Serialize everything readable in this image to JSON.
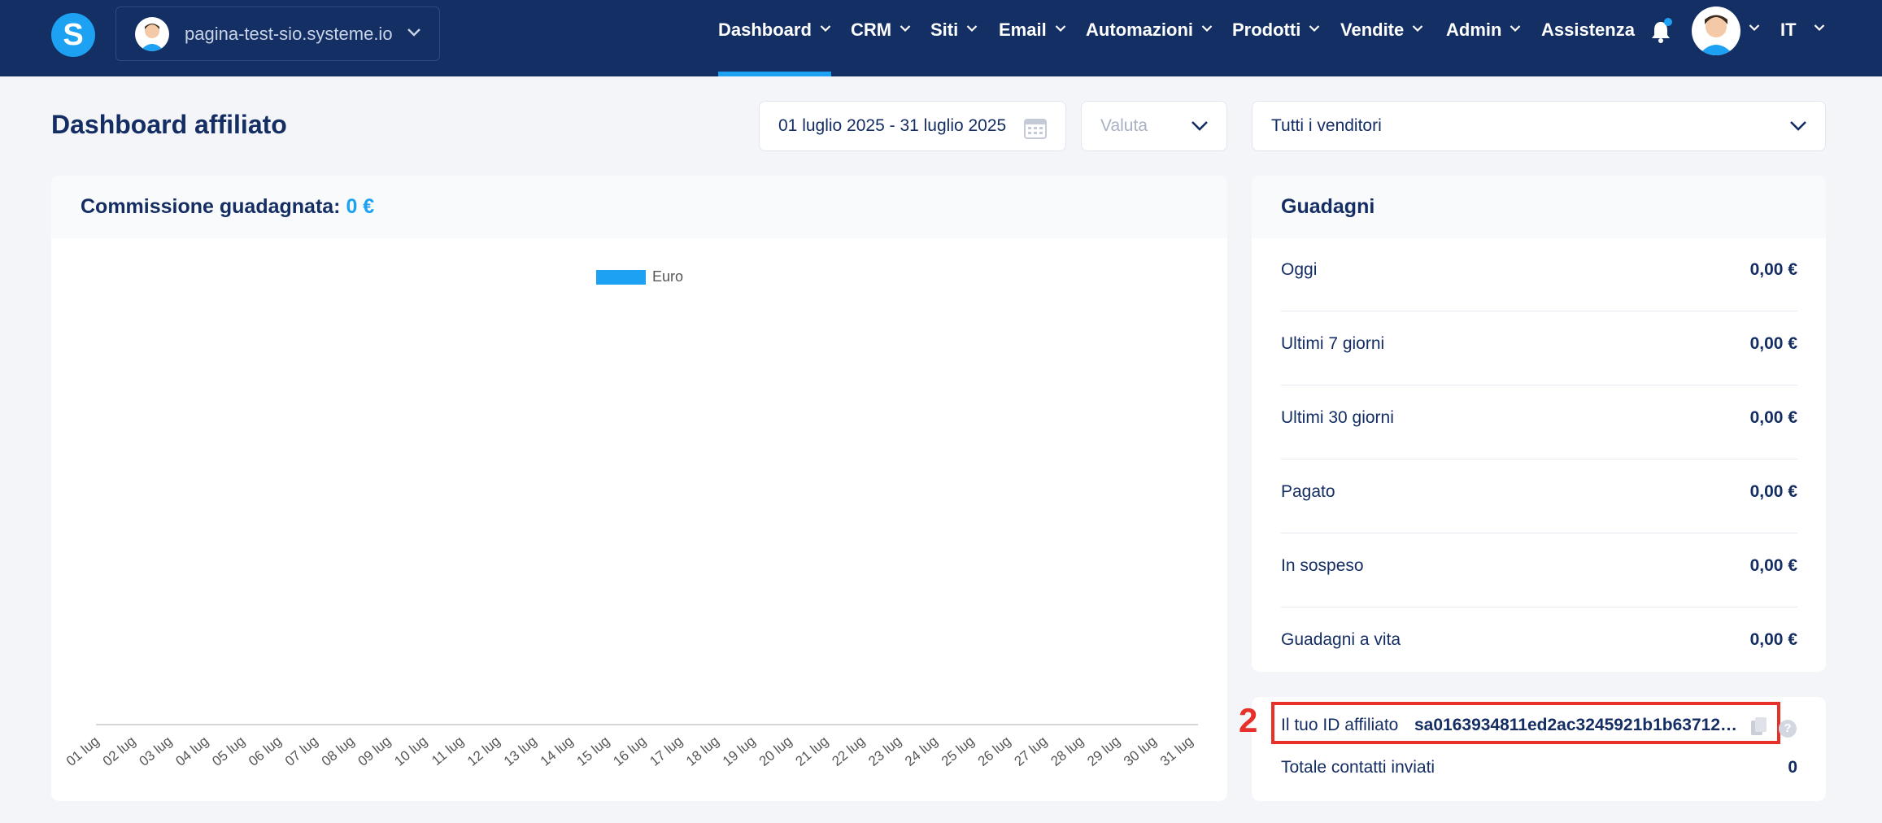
{
  "app": {
    "logo_letter": "S"
  },
  "site_switcher": {
    "name": "pagina-test-sio.systeme.io"
  },
  "nav": {
    "items": [
      {
        "label": "Dashboard"
      },
      {
        "label": "CRM"
      },
      {
        "label": "Siti"
      },
      {
        "label": "Email"
      },
      {
        "label": "Automazioni"
      },
      {
        "label": "Prodotti"
      },
      {
        "label": "Vendite"
      },
      {
        "label": "Admin"
      },
      {
        "label": "Assistenza"
      }
    ],
    "language": "IT"
  },
  "page": {
    "title": "Dashboard affiliato"
  },
  "filters": {
    "date_range": "01 luglio 2025 - 31 luglio 2025",
    "currency_placeholder": "Valuta",
    "vendor": "Tutti i venditori"
  },
  "commission_card": {
    "title": "Commissione guadagnata:",
    "value": "0 €"
  },
  "chart_data": {
    "type": "bar",
    "categories": [
      "01 lug",
      "02 lug",
      "03 lug",
      "04 lug",
      "05 lug",
      "06 lug",
      "07 lug",
      "08 lug",
      "09 lug",
      "10 lug",
      "11 lug",
      "12 lug",
      "13 lug",
      "14 lug",
      "15 lug",
      "16 lug",
      "17 lug",
      "18 lug",
      "19 lug",
      "20 lug",
      "21 lug",
      "22 lug",
      "23 lug",
      "24 lug",
      "25 lug",
      "26 lug",
      "27 lug",
      "28 lug",
      "29 lug",
      "30 lug",
      "31 lug"
    ],
    "series": [
      {
        "name": "Euro",
        "values": [
          0,
          0,
          0,
          0,
          0,
          0,
          0,
          0,
          0,
          0,
          0,
          0,
          0,
          0,
          0,
          0,
          0,
          0,
          0,
          0,
          0,
          0,
          0,
          0,
          0,
          0,
          0,
          0,
          0,
          0,
          0
        ],
        "color": "#1da1f2"
      }
    ],
    "legend_position": "top-center",
    "grid": false
  },
  "earnings_card": {
    "title": "Guadagni",
    "rows": [
      {
        "label": "Oggi",
        "value": "0,00 €"
      },
      {
        "label": "Ultimi 7 giorni",
        "value": "0,00 €"
      },
      {
        "label": "Ultimi 30 giorni",
        "value": "0,00 €"
      },
      {
        "label": "Pagato",
        "value": "0,00 €"
      },
      {
        "label": "In sospeso",
        "value": "0,00 €"
      },
      {
        "label": "Guadagni a vita",
        "value": "0,00 €"
      }
    ]
  },
  "affiliate": {
    "step_number": "2",
    "id_label": "Il tuo ID affiliato",
    "id_value": "sa0163934811ed2ac3245921b1b637125b...",
    "help": "?",
    "contacts_label": "Totale contatti inviati",
    "contacts_value": "0"
  },
  "colors": {
    "nav_bg": "#132f63",
    "accent": "#1da1f2",
    "highlight": "#e8302a"
  }
}
